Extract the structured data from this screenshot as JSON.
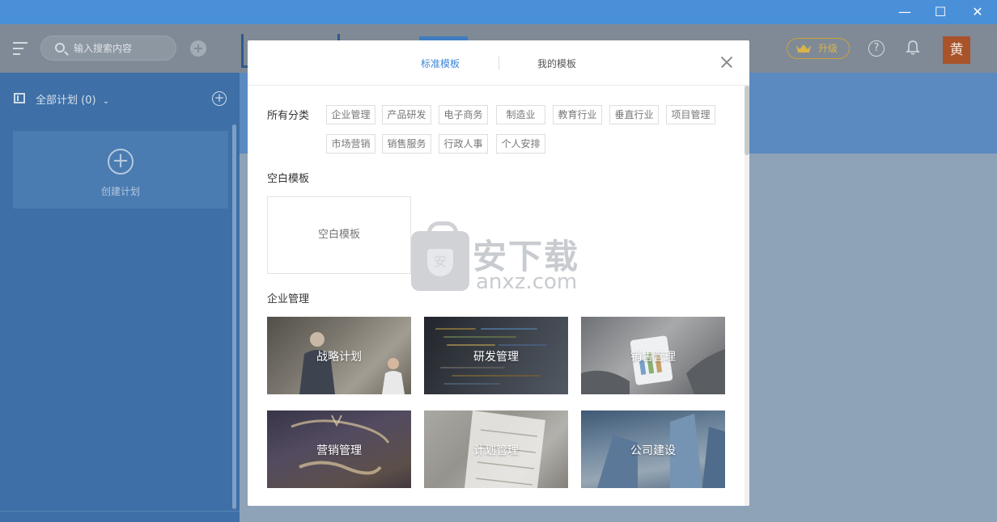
{
  "window": {
    "minimize": "—",
    "maximize": "☐",
    "close": "✕"
  },
  "header": {
    "search_placeholder": "输入搜索内容",
    "add": "+",
    "upgrade": "升级",
    "help": "?",
    "avatar": "黄"
  },
  "sidebar": {
    "title": "全部计划 (0)",
    "add": "+",
    "create_label": "创建计划",
    "create_plus": "+"
  },
  "modal": {
    "tabs": [
      "标准模板",
      "我的模板"
    ],
    "active_tab": 0,
    "category_title": "所有分类",
    "categories": [
      "企业管理",
      "产品研发",
      "电子商务",
      "制造业",
      "教育行业",
      "垂直行业",
      "项目管理",
      "市场营销",
      "销售服务",
      "行政人事",
      "个人安排"
    ],
    "blank_section": "空白模板",
    "blank_card": "空白模板",
    "enterprise_section": "企业管理",
    "templates": [
      "战略计划",
      "研发管理",
      "销售管理",
      "营销管理",
      "计划管理",
      "公司建设"
    ]
  },
  "watermark": {
    "cn": "安下载",
    "en": "anxz.com",
    "shield": "安"
  },
  "colors": {
    "accent": "#3d86d8",
    "titlebar": "#4a90d9",
    "avatar": "#a9532a",
    "upgrade": "#d9b44a"
  }
}
